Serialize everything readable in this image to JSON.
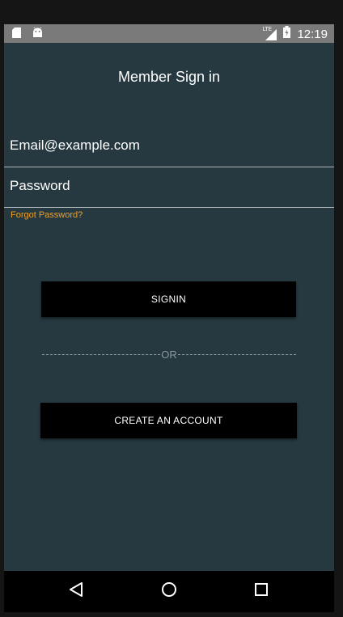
{
  "status_bar": {
    "time": "12:19",
    "network_label": "LTE",
    "left_icons": [
      "sd-card-icon",
      "android-icon"
    ],
    "right_icons": [
      "signal-icon",
      "battery-charging-icon"
    ]
  },
  "header": {
    "title": "Member Sign in"
  },
  "form": {
    "email_value": "Email@example.com",
    "password_value": "Password",
    "forgot_password_label": "Forgot Password?"
  },
  "actions": {
    "signin_label": "SIGNIN",
    "divider_label": "OR",
    "create_account_label": "CREATE AN ACCOUNT"
  },
  "nav_bar": {
    "icons": [
      "back-icon",
      "home-icon",
      "recents-icon"
    ]
  },
  "colors": {
    "background": "#263940",
    "status_bar": "#7a7a7a",
    "accent_link": "#f0a020",
    "button": "#000000",
    "text": "#ffffff"
  }
}
